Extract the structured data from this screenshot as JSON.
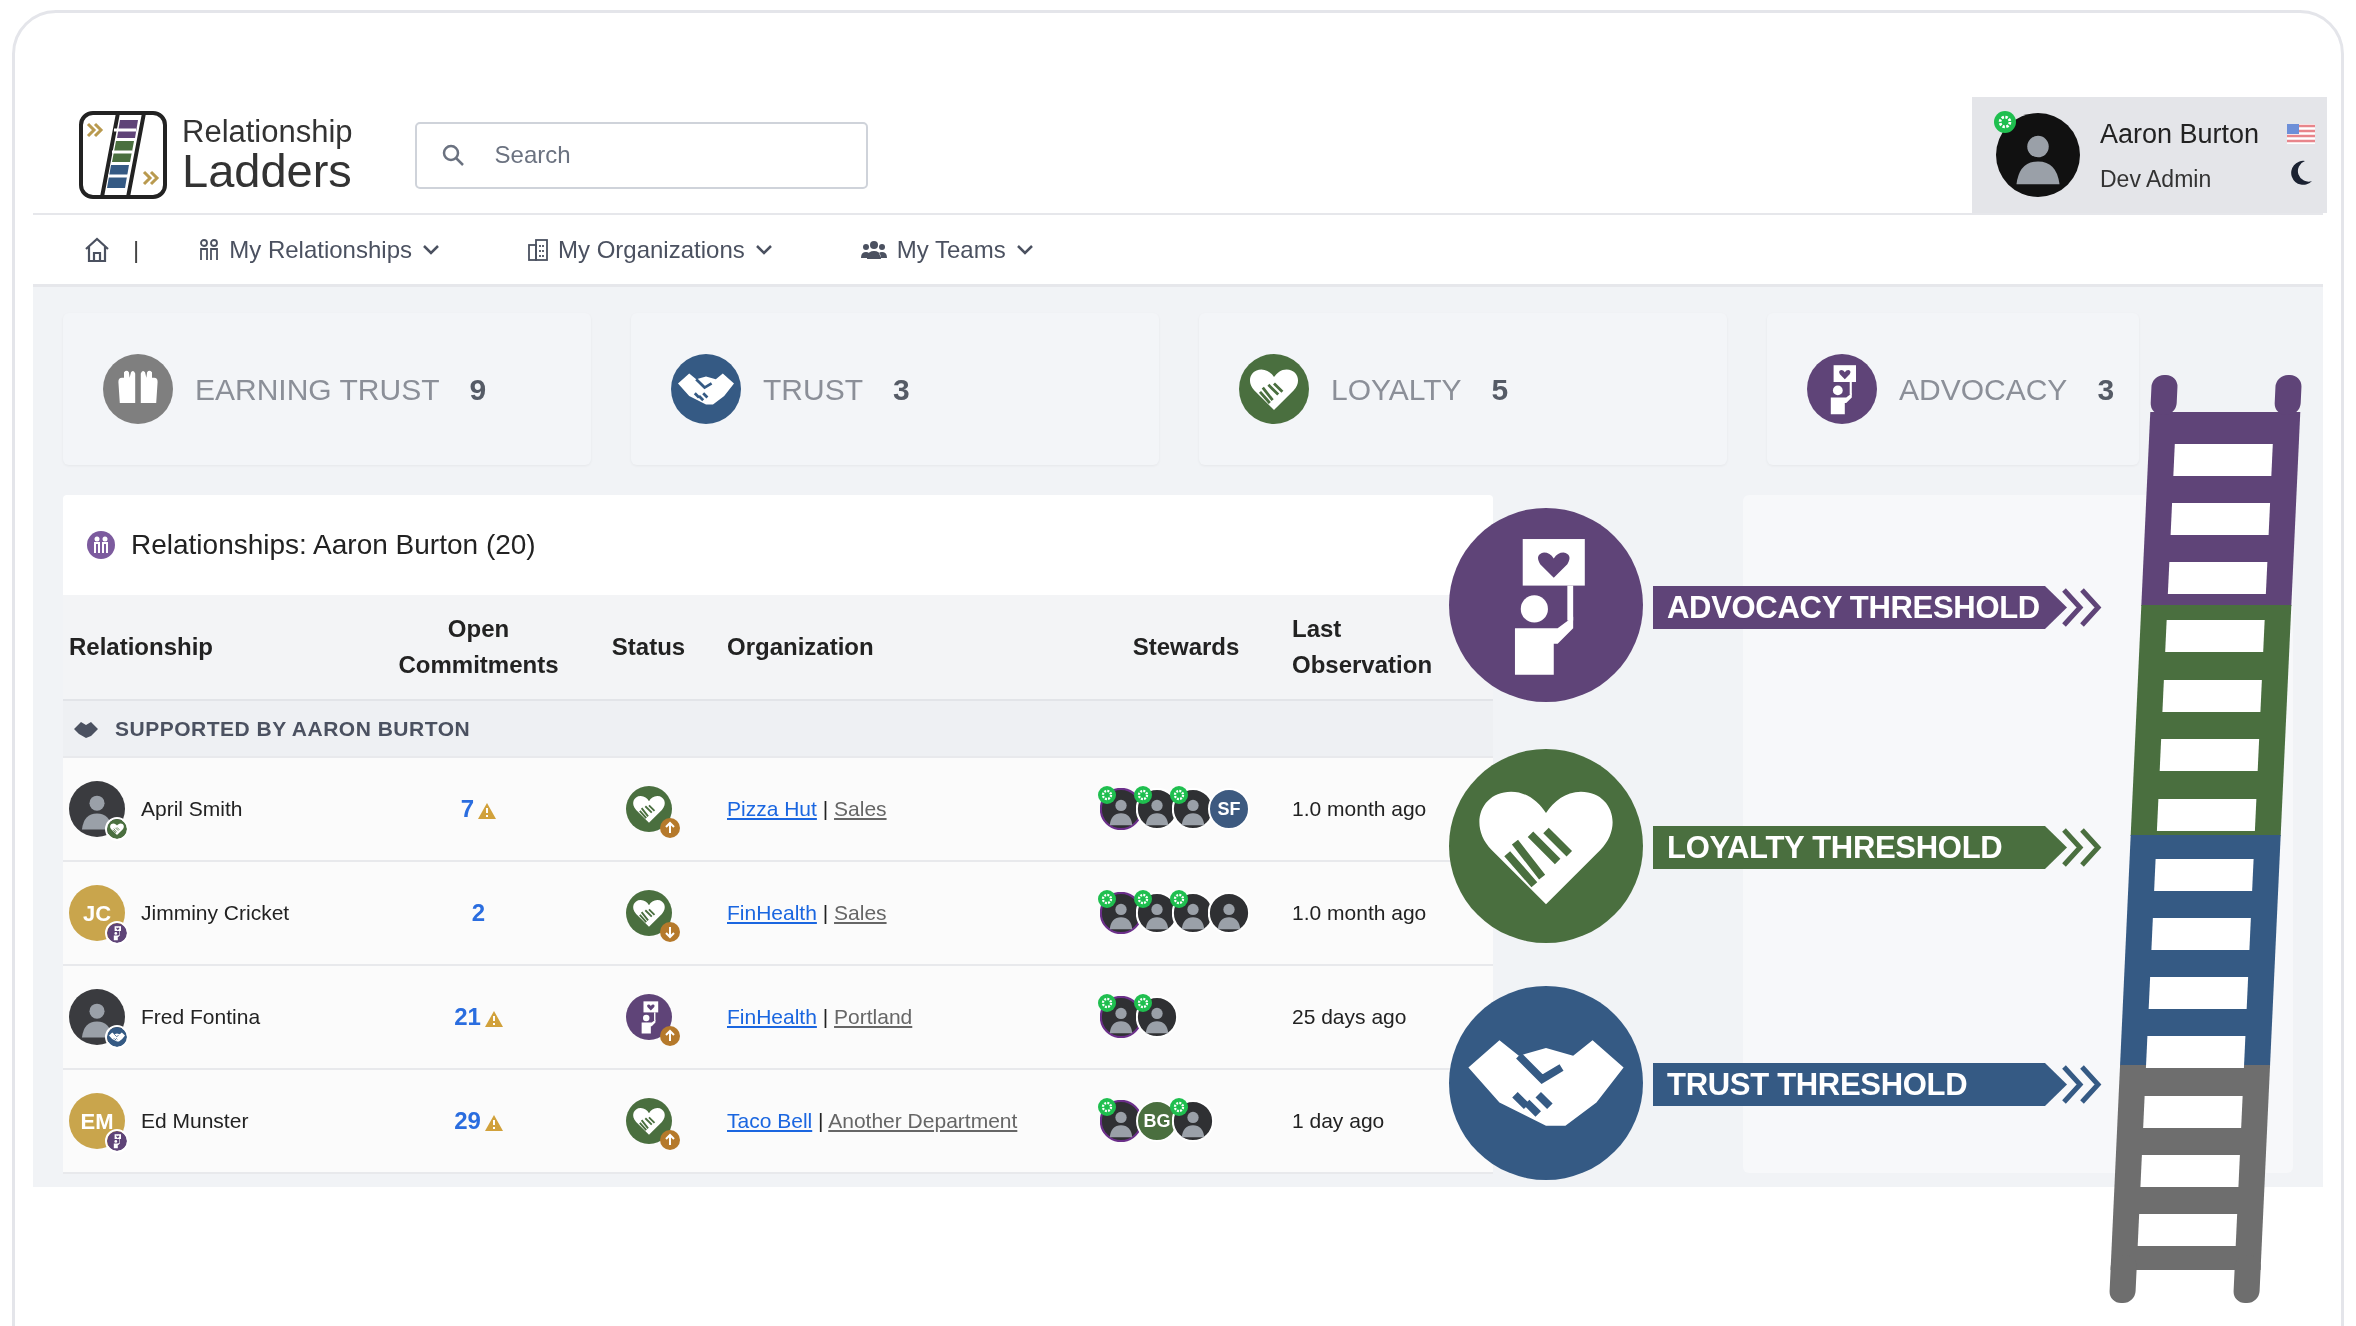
{
  "brand": {
    "line1": "Relationship",
    "line2": "Ladders"
  },
  "search": {
    "placeholder": "Search"
  },
  "user": {
    "name": "Aaron Burton",
    "role": "Dev Admin"
  },
  "nav": {
    "separator": "|",
    "items": [
      {
        "label": "My Relationships",
        "kind": "people"
      },
      {
        "label": "My Organizations",
        "kind": "building"
      },
      {
        "label": "My Teams",
        "kind": "team"
      }
    ]
  },
  "stages": [
    {
      "kind": "earning",
      "label": "EARNING TRUST",
      "count": "9",
      "color": "#7f7f7f"
    },
    {
      "kind": "trust",
      "label": "TRUST",
      "count": "3",
      "color": "#355a84"
    },
    {
      "kind": "loyalty",
      "label": "LOYALTY",
      "count": "5",
      "color": "#4a6f3f"
    },
    {
      "kind": "advocacy",
      "label": "ADVOCACY",
      "count": "3",
      "color": "#5f4478"
    }
  ],
  "relationships": {
    "title": "Relationships: Aaron Burton (20)",
    "columns": [
      "Relationship",
      "Open Commitments",
      "Status",
      "Organization",
      "Stewards",
      "Last Observation"
    ],
    "group": "SUPPORTED BY AARON BURTON",
    "rows": [
      {
        "name": "April Smith",
        "avatar": {
          "kind": "photo"
        },
        "badge": {
          "kind": "loyalty"
        },
        "commitments": "7",
        "warning": true,
        "status": {
          "kind": "loyalty",
          "rising": true
        },
        "org": "Pizza Hut",
        "separator": "|",
        "dept": "Sales",
        "stewards": [
          {
            "kind": "photo",
            "ring": true,
            "gear": true
          },
          {
            "kind": "photo",
            "ring": false,
            "gear": true
          },
          {
            "kind": "photo",
            "ring": false,
            "gear": true
          },
          {
            "kind": "initials",
            "initials": "SF",
            "color": "#3d5a80",
            "ring": false,
            "gear": false
          }
        ],
        "last": "1.0 month ago"
      },
      {
        "name": "Jimminy Cricket",
        "avatar": {
          "kind": "initials",
          "initials": "JC"
        },
        "badge": {
          "kind": "advocacy"
        },
        "commitments": "2",
        "warning": false,
        "status": {
          "kind": "loyalty",
          "rising": false
        },
        "org": "FinHealth",
        "separator": "|",
        "dept": "Sales",
        "stewards": [
          {
            "kind": "photo",
            "ring": true,
            "gear": true
          },
          {
            "kind": "photo",
            "ring": false,
            "gear": true
          },
          {
            "kind": "photo",
            "ring": false,
            "gear": true
          },
          {
            "kind": "photo",
            "ring": false,
            "gear": false
          }
        ],
        "last": "1.0 month ago"
      },
      {
        "name": "Fred Fontina",
        "avatar": {
          "kind": "photo"
        },
        "badge": {
          "kind": "trust"
        },
        "commitments": "21",
        "warning": true,
        "status": {
          "kind": "advocacy",
          "rising": true
        },
        "org": "FinHealth",
        "separator": "|",
        "dept": "Portland",
        "stewards": [
          {
            "kind": "photo",
            "ring": true,
            "gear": true
          },
          {
            "kind": "photo",
            "ring": false,
            "gear": true
          }
        ],
        "last": "25 days ago"
      },
      {
        "name": "Ed Munster",
        "avatar": {
          "kind": "initials",
          "initials": "EM"
        },
        "badge": {
          "kind": "advocacy"
        },
        "commitments": "29",
        "warning": true,
        "status": {
          "kind": "loyalty",
          "rising": true
        },
        "org": "Taco Bell",
        "separator": "|",
        "dept": "Another Department",
        "stewards": [
          {
            "kind": "photo",
            "ring": true,
            "gear": true
          },
          {
            "kind": "initials",
            "initials": "BG",
            "color": "#4a6f3f",
            "ring": false,
            "gear": false
          },
          {
            "kind": "photo",
            "ring": false,
            "gear": true
          }
        ],
        "last": "1 day ago"
      }
    ]
  },
  "thresholds": [
    {
      "kind": "advocacy",
      "label": "ADVOCACY THRESHOLD",
      "color": "#5f4478"
    },
    {
      "kind": "loyalty",
      "label": "LOYALTY THRESHOLD",
      "color": "#4a6f3f"
    },
    {
      "kind": "trust",
      "label": "TRUST THRESHOLD",
      "color": "#355a84"
    }
  ]
}
